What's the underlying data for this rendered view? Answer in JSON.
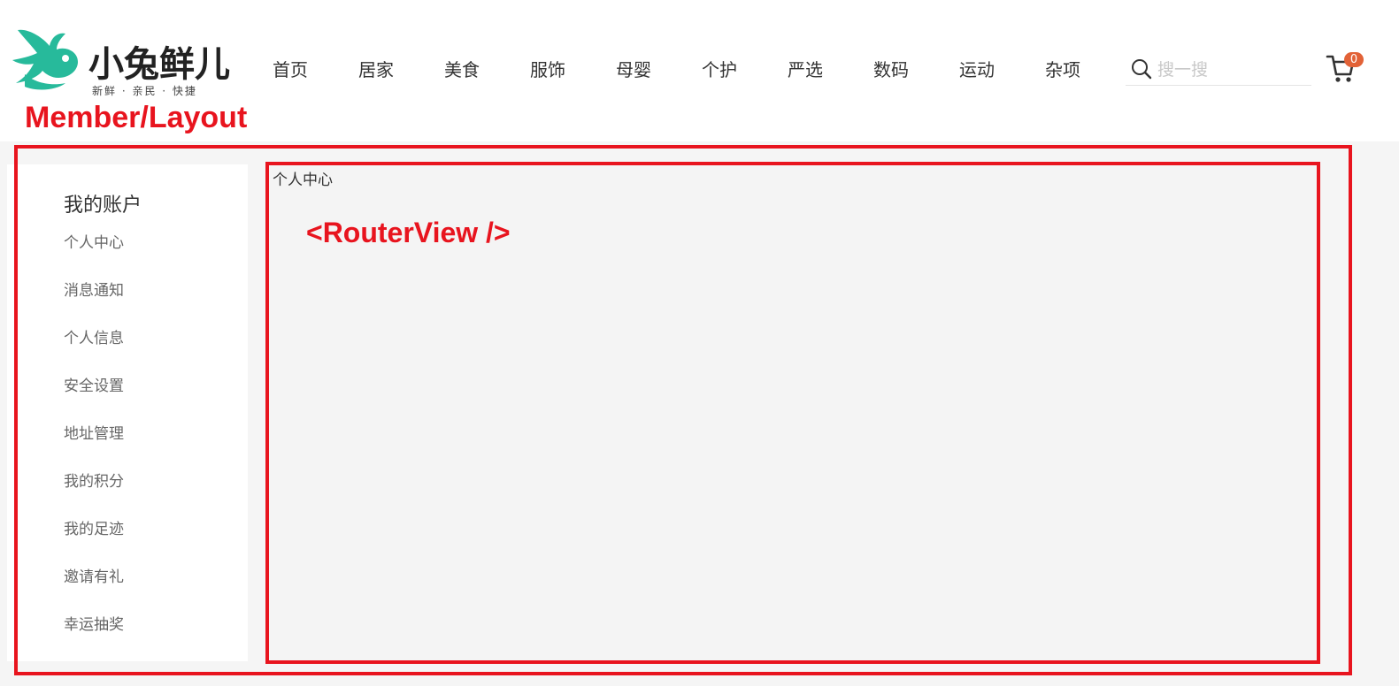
{
  "logo": {
    "title": "小兔鲜儿",
    "slogan": "新鲜 · 亲民 · 快捷",
    "brand_color": "#27ba9b"
  },
  "nav": {
    "items": [
      "首页",
      "居家",
      "美食",
      "服饰",
      "母婴",
      "个护",
      "严选",
      "数码",
      "运动",
      "杂项"
    ]
  },
  "search": {
    "placeholder": "搜一搜",
    "icon": "search-icon"
  },
  "cart": {
    "icon": "cart-icon",
    "count": "0",
    "badge_color": "#e26237"
  },
  "annotations": {
    "member_layout": "Member/Layout",
    "router_view": "<RouterView />",
    "color": "#e8141e"
  },
  "sidebar": {
    "title": "我的账户",
    "items": [
      "个人中心",
      "消息通知",
      "个人信息",
      "安全设置",
      "地址管理",
      "我的积分",
      "我的足迹",
      "邀请有礼",
      "幸运抽奖"
    ]
  },
  "content": {
    "text": "个人中心"
  }
}
